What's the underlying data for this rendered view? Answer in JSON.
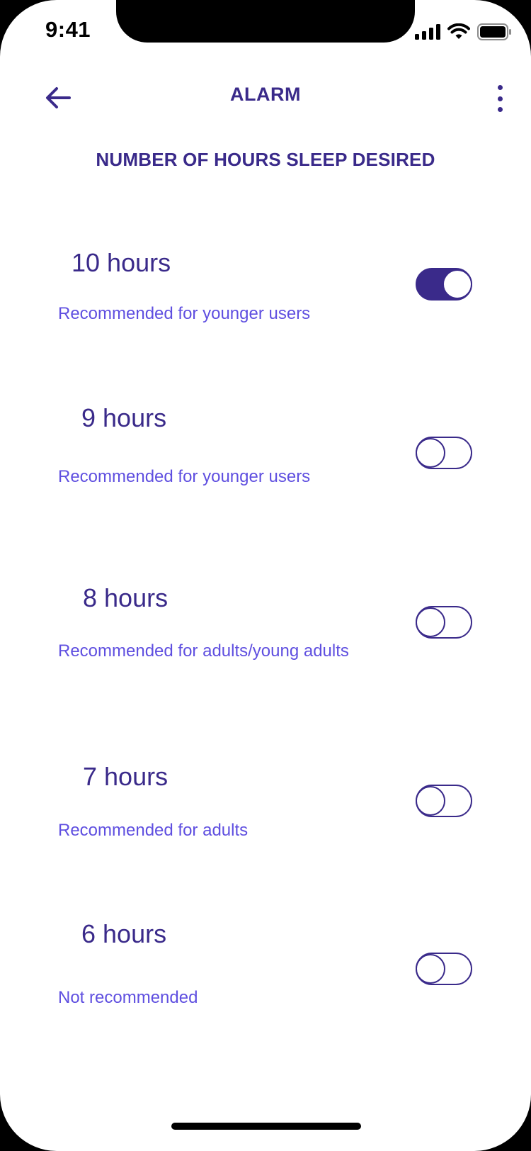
{
  "status_bar": {
    "time": "9:41",
    "icons": [
      "signal-icon",
      "wifi-icon",
      "battery-icon"
    ]
  },
  "header": {
    "title": "ALARM",
    "back_icon": "arrow-left-icon",
    "menu_icon": "more-vertical-icon"
  },
  "section": {
    "heading": "NUMBER OF HOURS SLEEP DESIRED"
  },
  "options": [
    {
      "hours": "10 hours",
      "description": "Recommended for younger users",
      "enabled": true
    },
    {
      "hours": "9 hours",
      "description": "Recommended for younger users",
      "enabled": false
    },
    {
      "hours": "8 hours",
      "description": "Recommended for adults/young adults",
      "enabled": false
    },
    {
      "hours": "7 hours",
      "description": "Recommended for adults",
      "enabled": false
    },
    {
      "hours": "6 hours",
      "description": "Not recommended",
      "enabled": false
    }
  ],
  "colors": {
    "accent": "#3a2a8a",
    "description_text": "#5f4fe0",
    "background": "#ffffff"
  }
}
